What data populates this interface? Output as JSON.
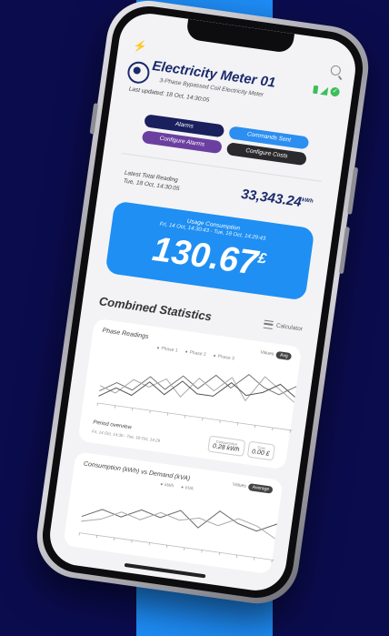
{
  "app": {
    "meter_title": "Electricity Meter 01",
    "meter_subtitle": "3-Phase Bypassed Coil Electricity Meter",
    "last_updated": "Last updated: 18 Oct, 14:30:05"
  },
  "actions": {
    "alarms": "Alarms",
    "commands_sent": "Commands Sent",
    "configure_alarms": "Configure Alarms",
    "configure_costs": "Configure Costs"
  },
  "reading": {
    "label": "Latest Total Reading",
    "date": "Tue, 18 Oct, 14:30:05",
    "value": "33,343.24",
    "unit": "kWh"
  },
  "usage": {
    "label": "Usage Consumption",
    "range": "Fri, 14 Oct, 14:30:43 - Tue, 18 Oct, 14:29:43",
    "value": "130.67",
    "currency": "£"
  },
  "stats": {
    "title": "Combined Statistics",
    "action_label": "Calculator"
  },
  "phase_card": {
    "title": "Phase Readings",
    "toggle_off": "Values",
    "toggle_on": "Avg",
    "legend": [
      "Phase 1",
      "Phase 2",
      "Phase 3"
    ],
    "series": [
      [
        2,
        4,
        3,
        6,
        4,
        7,
        5,
        8,
        6,
        9,
        7,
        6,
        8
      ],
      [
        3,
        2,
        5,
        4,
        6,
        3,
        7,
        5,
        8,
        4,
        9,
        7,
        5
      ],
      [
        1,
        3,
        2,
        5,
        3,
        6,
        4,
        4,
        7,
        5,
        6,
        8,
        6
      ]
    ]
  },
  "period": {
    "label": "Period overview",
    "range": "Fri, 14 Oct, 14:30 - Tue, 18 Oct, 14:29",
    "box1_key": "Consumption",
    "box1_val": "0.28 kWh",
    "box2_key": "Cost",
    "box2_val": "0.00 £"
  },
  "consumption_card": {
    "title": "Consumption (kWh) vs Demand (kVA)",
    "toggle_off": "Values",
    "toggle_on": "Average",
    "legend": [
      "kWh",
      "kVA"
    ],
    "series": [
      [
        3,
        5,
        4,
        6,
        5,
        7,
        4,
        8,
        6,
        5,
        7
      ],
      [
        2,
        3,
        5,
        4,
        6,
        5,
        6,
        5,
        7,
        6,
        4
      ]
    ]
  },
  "colors": {
    "navy": "#1a2a6c",
    "accent_blue": "#1f8ff3",
    "status_green": "#3cbf5a",
    "background": "#0b0c4e"
  }
}
